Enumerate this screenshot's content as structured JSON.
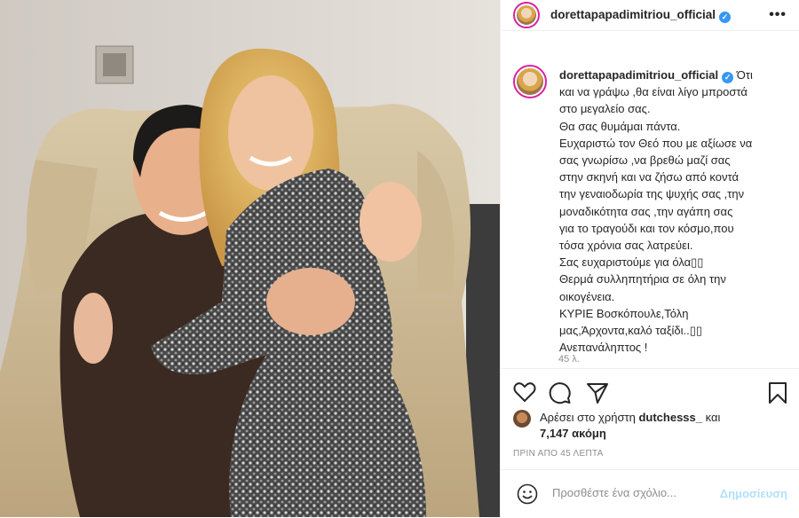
{
  "header": {
    "username": "dorettapapadimitriou_official",
    "more_label": "•••"
  },
  "caption": {
    "username": "dorettapapadimitriou_official",
    "lines": [
      "Ότι",
      "και να γράψω ,θα είναι λίγο μπροστά",
      "στο μεγαλείο σας.",
      "Θα σας θυμάμαι πάντα.",
      "Ευχαριστώ τον Θεό που με αξίωσε να",
      "σας γνωρίσω ,να βρεθώ μαζί σας",
      "στην σκηνή και να ζήσω από κοντά",
      "την γεναιοδωρία της ψυχής σας ,την",
      "μοναδικότητα σας ,την αγάπη σας",
      "για το τραγούδι και τον κόσμο,που",
      "τόσα χρόνια σας λατρεύει.",
      "Σας ευχαριστούμε για όλα▯▯",
      "Θερμά συλληπητήρια σε όλη την",
      "οικογένεια.",
      "ΚΥΡΙΕ Βοσκόπουλε,Τόλη",
      "μας,Άρχοντα,καλό ταξίδι..▯▯",
      "Ανεπανάληπτος !"
    ],
    "time": "45 λ."
  },
  "likes": {
    "prefix": "Αρέσει στο χρήστη",
    "user": "dutchesss_",
    "and": "και",
    "count": "7,147 ακόμη"
  },
  "posted": "ΠΡΙΝ ΑΠΟ 45 ΛΕΠΤΑ",
  "comment": {
    "placeholder": "Προσθέστε ένα σχόλιο...",
    "post_label": "Δημοσίευση"
  },
  "colors": {
    "verified": "#3897f0",
    "post_disabled": "#b2dffc",
    "meta": "#8e8e8e"
  }
}
